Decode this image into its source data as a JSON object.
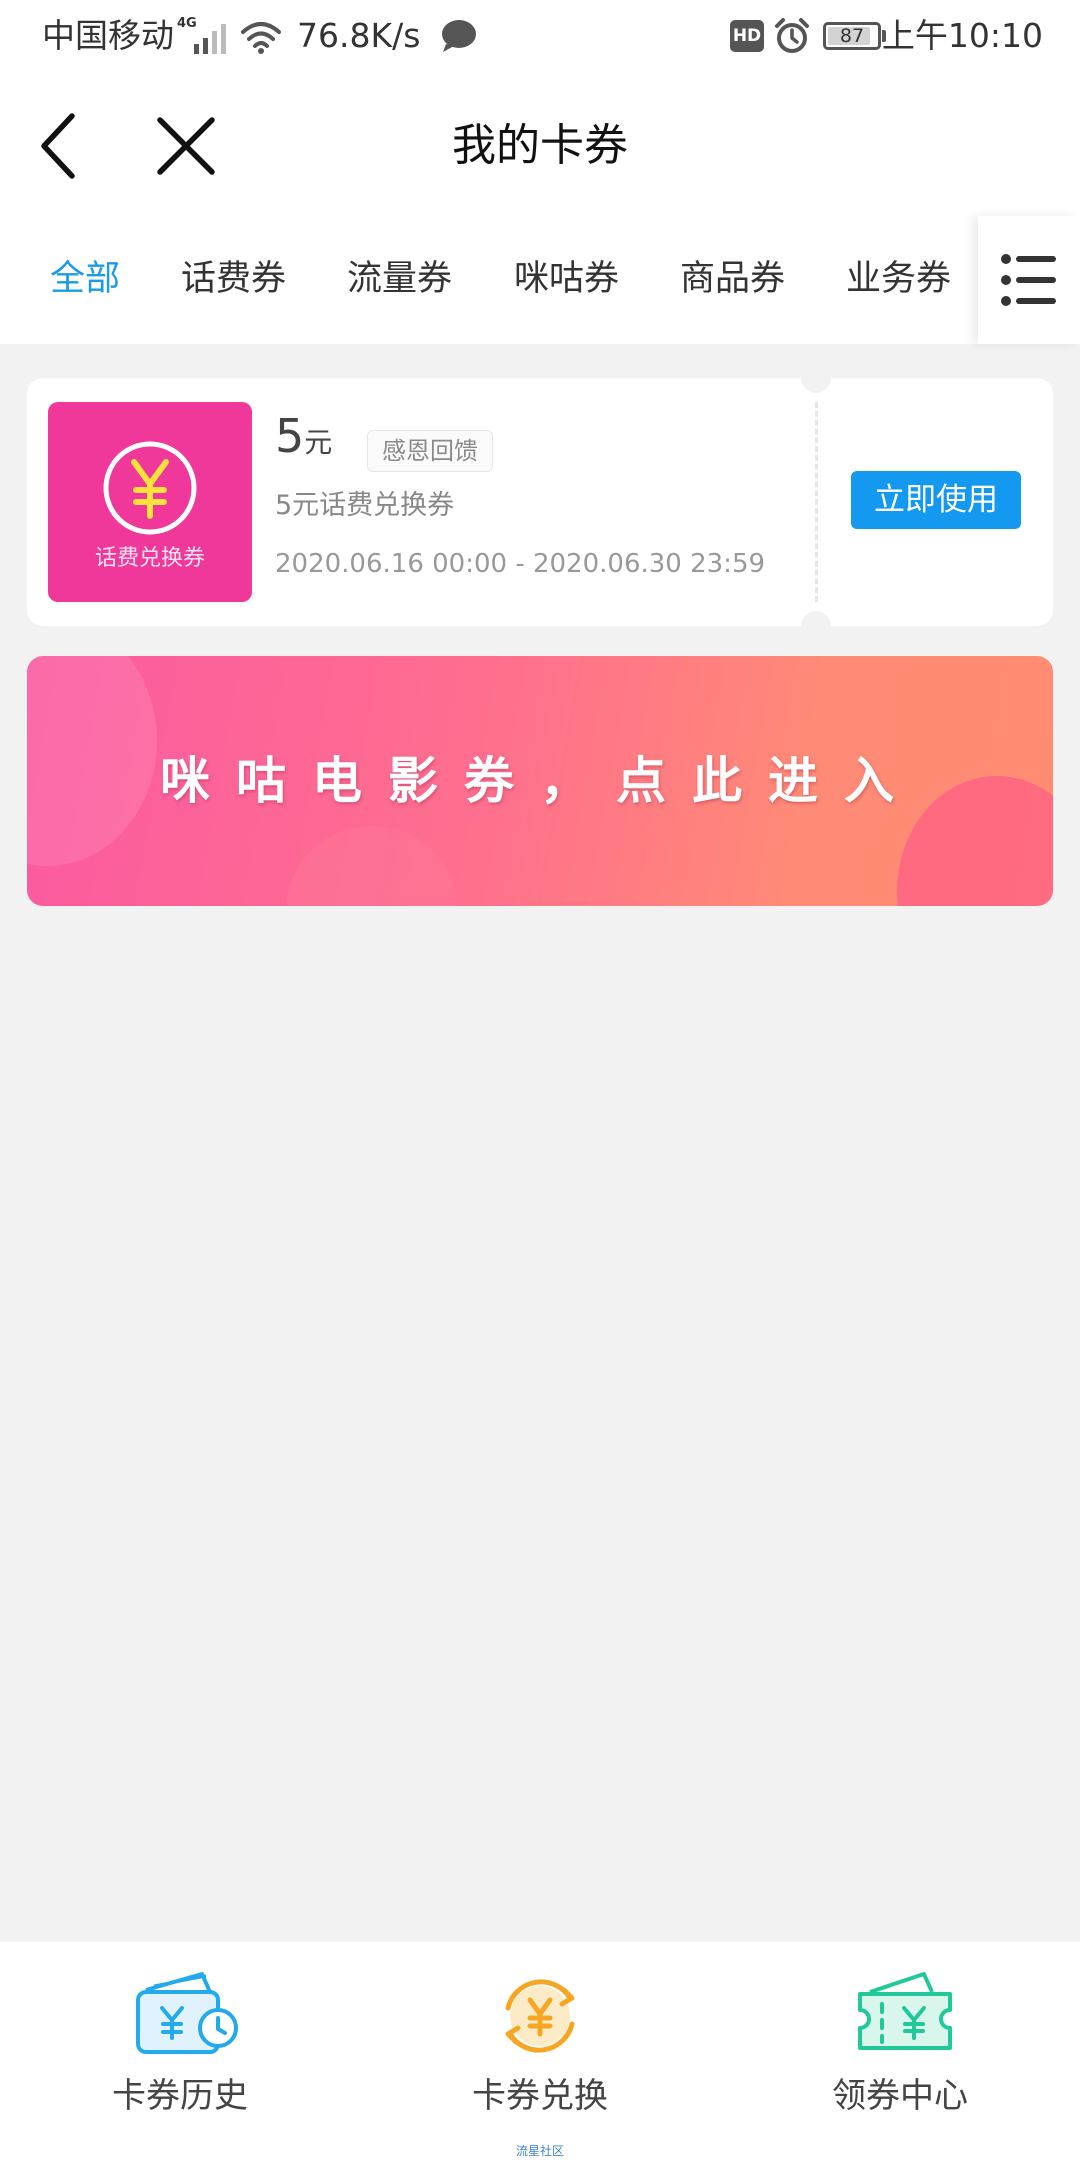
{
  "status_bar": {
    "carrier": "中国移动",
    "network": "4G",
    "speed": "76.8K/s",
    "hd": "HD",
    "battery": "87",
    "battery_level": 0.87,
    "time": "上午10:10"
  },
  "header": {
    "title": "我的卡券",
    "back_icon": "back-arrow-icon",
    "close_icon": "close-icon"
  },
  "tabs": {
    "items": [
      {
        "label": "全部",
        "active": true
      },
      {
        "label": "话费券",
        "active": false
      },
      {
        "label": "流量券",
        "active": false
      },
      {
        "label": "咪咕券",
        "active": false
      },
      {
        "label": "商品券",
        "active": false
      },
      {
        "label": "业务券",
        "active": false
      }
    ],
    "menu_icon": "list-menu-icon"
  },
  "coupon": {
    "thumb_label": "话费兑换券",
    "amount": "5",
    "unit": "元",
    "tag": "感恩回馈",
    "name": "5元话费兑换券",
    "validity": "2020.06.16 00:00 - 2020.06.30 23:59",
    "use_button": "立即使用",
    "thumb_color": "#f0389b",
    "button_color": "#1399ef"
  },
  "banner": {
    "text": "咪咕电影券，点此进入"
  },
  "bottom_nav": {
    "items": [
      {
        "label": "卡券历史",
        "icon": "wallet-history-icon",
        "color": "#22a9ee"
      },
      {
        "label": "卡券兑换",
        "icon": "exchange-yuan-icon",
        "color": "#f6a623"
      },
      {
        "label": "领券中心",
        "icon": "ticket-yuan-icon",
        "color": "#21c89a"
      }
    ],
    "watermark": "流星社区"
  },
  "colors": {
    "accent": "#1a9be9",
    "background": "#f3f2f3"
  }
}
